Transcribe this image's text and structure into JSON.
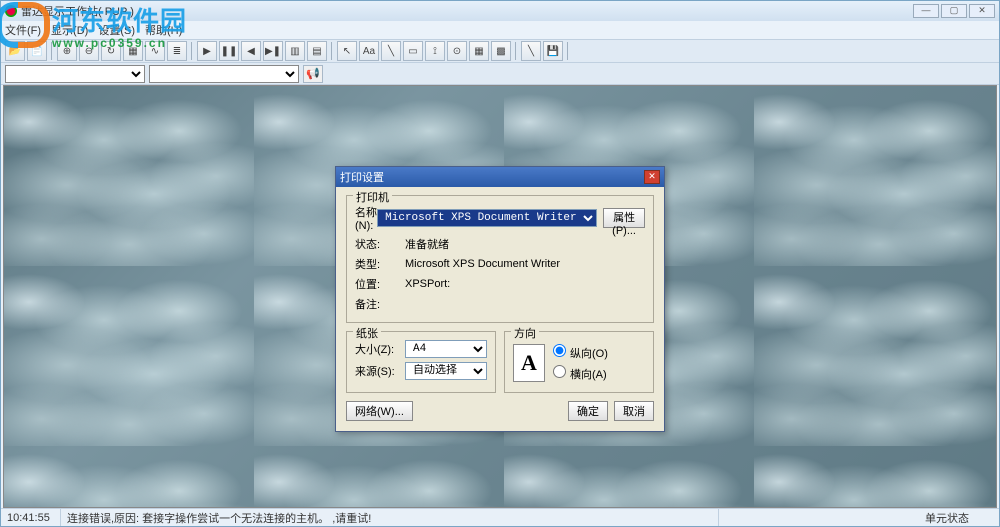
{
  "window": {
    "title": "雷达显示工作站( PUP )",
    "btn_min": "—",
    "btn_max": "▢",
    "btn_close": "✕"
  },
  "menubar": {
    "items": [
      "文件(F)",
      "显示(D)",
      "设置(S)",
      "帮助(H)"
    ]
  },
  "toolbar2": {
    "speaker": "📢"
  },
  "status": {
    "time": "10:41:55",
    "message": "连接错误,原因: 套接字操作尝试一个无法连接的主机。  ,请重试!",
    "unit": "单元状态"
  },
  "dialog": {
    "title": "打印设置",
    "close": "✕",
    "printer": {
      "legend": "打印机",
      "name_label": "名称(N):",
      "name_value": "Microsoft XPS Document Writer",
      "properties_btn": "属性(P)...",
      "status_label": "状态:",
      "status_value": "准备就绪",
      "type_label": "类型:",
      "type_value": "Microsoft XPS Document Writer",
      "where_label": "位置:",
      "where_value": "XPSPort:",
      "comment_label": "备注:",
      "comment_value": ""
    },
    "paper": {
      "legend": "纸张",
      "size_label": "大小(Z):",
      "size_value": "A4",
      "source_label": "来源(S):",
      "source_value": "自动选择"
    },
    "orientation": {
      "legend": "方向",
      "portrait": "纵向(O)",
      "landscape": "横向(A)",
      "glyph": "A"
    },
    "network_btn": "网络(W)...",
    "ok_btn": "确定",
    "cancel_btn": "取消"
  },
  "watermark": {
    "text": "河东软件园",
    "url": "www.pc0359.cn"
  }
}
